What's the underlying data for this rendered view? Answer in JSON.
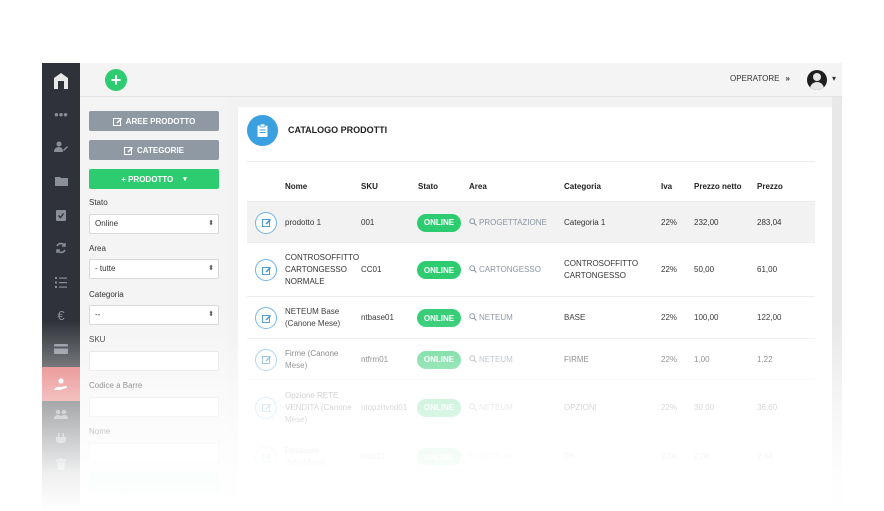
{
  "topbar": {
    "operator_label": "OPERATORE",
    "operator_chevron": "»",
    "caret": "▾"
  },
  "filters": {
    "btn_aree": "AREE PRODOTTO",
    "btn_categorie": "CATEGORIE",
    "btn_prodotto": "+ PRODOTTO",
    "btn_prodotto_caret": "▾",
    "stato_label": "Stato",
    "stato_value": "Online",
    "area_label": "Area",
    "area_value": "- tutte",
    "categoria_label": "Categoria",
    "categoria_value": "--",
    "sku_label": "SKU",
    "codice_label": "Codice a Barre",
    "nome_label": "Nome"
  },
  "main": {
    "title": "CATALOGO PRODOTTI",
    "columns": [
      "Nome",
      "SKU",
      "Stato",
      "Area",
      "Categoria",
      "Iva",
      "Prezzo netto",
      "Prezzo"
    ],
    "rows": [
      {
        "nome": "prodotto 1",
        "sku": "001",
        "stato": "ONLINE",
        "area": "PROGETTAZIONE",
        "categoria": "Categoria 1",
        "iva": "22%",
        "netto": "232,00",
        "prezzo": "283,04"
      },
      {
        "nome": "CONTROSOFFITTO CARTONGESSO NORMALE",
        "sku": "CC01",
        "stato": "ONLINE",
        "area": "CARTONGESSO",
        "categoria": "CONTROSOFFITTO CARTONGESSO",
        "iva": "22%",
        "netto": "50,00",
        "prezzo": "61,00"
      },
      {
        "nome": "NETEUM Base (Canone Mese)",
        "sku": "ntbase01",
        "stato": "ONLINE",
        "area": "NETEUM",
        "categoria": "BASE",
        "iva": "22%",
        "netto": "100,00",
        "prezzo": "122,00"
      },
      {
        "nome": "Firme (Canone Mese)",
        "sku": "ntfrm01",
        "stato": "ONLINE",
        "area": "NETEUM",
        "categoria": "FIRME",
        "iva": "22%",
        "netto": "1,00",
        "prezzo": "1,22"
      },
      {
        "nome": "Opzione RETE VENDITA (Canone Mese)",
        "sku": "ntopzrtvnd01",
        "stato": "ONLINE",
        "area": "NETEUM",
        "categoria": "OPZIONI",
        "iva": "22%",
        "netto": "30,00",
        "prezzo": "36,60"
      },
      {
        "nome": "Database (Info/Mese)",
        "sku": "ntdb01",
        "stato": "ONLINE",
        "area": "NETEUM",
        "categoria": "DB",
        "iva": "22%",
        "netto": "2,00",
        "prezzo": "2,44"
      }
    ]
  },
  "colors": {
    "green": "#2ecc71",
    "blue": "#3aa0e0",
    "rail": "#2f3238",
    "rail_active": "#e36a6a"
  }
}
